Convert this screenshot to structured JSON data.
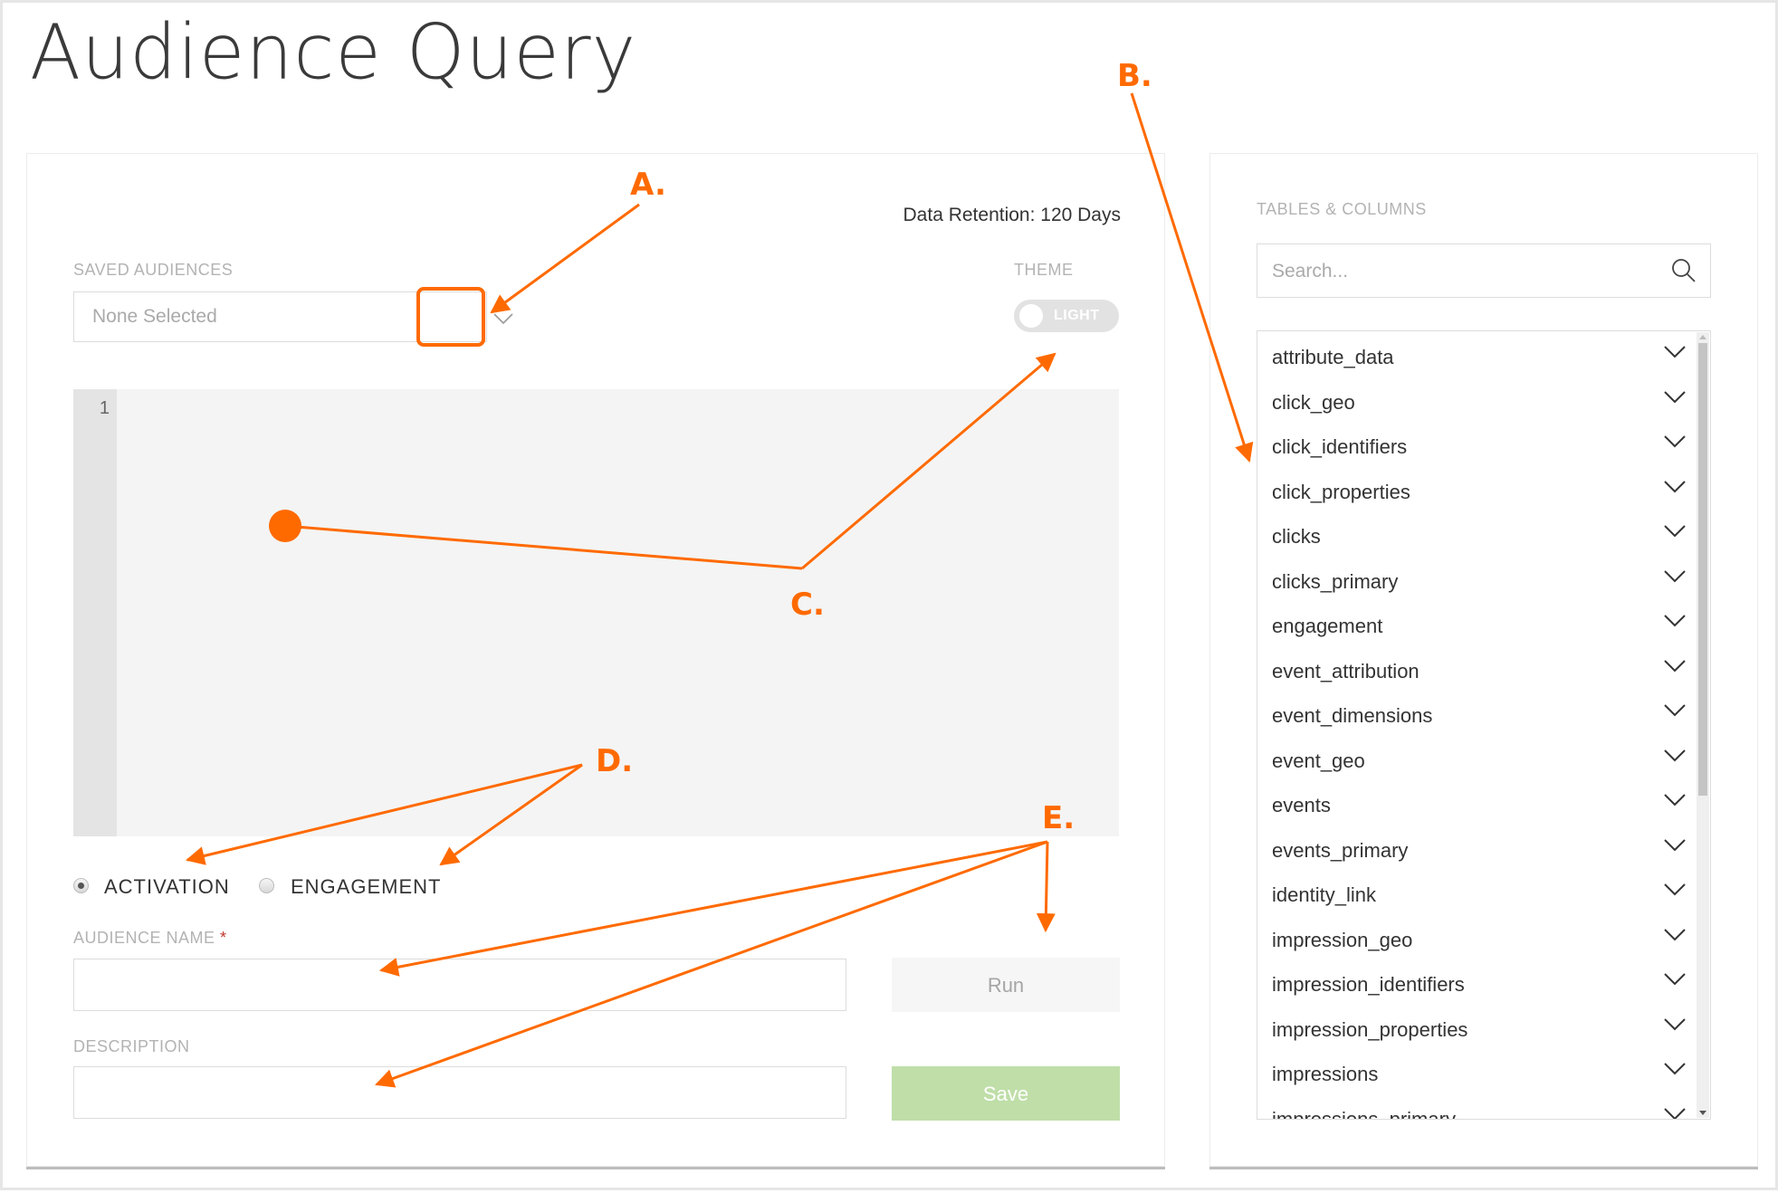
{
  "page": {
    "title": "Audience Query"
  },
  "query_panel": {
    "data_retention": "Data Retention: 120 Days",
    "saved_audiences": {
      "label": "SAVED AUDIENCES",
      "value": "None Selected"
    },
    "theme": {
      "label": "THEME",
      "value": "LIGHT"
    },
    "editor": {
      "line_numbers": [
        "1"
      ],
      "content": ""
    },
    "audience_type": {
      "options": [
        {
          "label": "ACTIVATION",
          "checked": true
        },
        {
          "label": "ENGAGEMENT",
          "checked": false
        }
      ]
    },
    "audience_name": {
      "label": "AUDIENCE NAME",
      "required_mark": "*",
      "value": ""
    },
    "description": {
      "label": "DESCRIPTION",
      "value": ""
    },
    "run_label": "Run",
    "save_label": "Save"
  },
  "tables_panel": {
    "label": "TABLES & COLUMNS",
    "search_placeholder": "Search...",
    "tables": [
      "attribute_data",
      "click_geo",
      "click_identifiers",
      "click_properties",
      "clicks",
      "clicks_primary",
      "engagement",
      "event_attribution",
      "event_dimensions",
      "event_geo",
      "events",
      "events_primary",
      "identity_link",
      "impression_geo",
      "impression_identifiers",
      "impression_properties",
      "impressions",
      "impressions_primary"
    ]
  },
  "annotations": {
    "color": "#ff6a00",
    "labels": [
      "A.",
      "B.",
      "C.",
      "D.",
      "E."
    ]
  },
  "icons": {
    "saved_audiences_toggle": "chevron-down-icon",
    "search": "search-icon",
    "table_expand": "chevron-down-icon"
  }
}
